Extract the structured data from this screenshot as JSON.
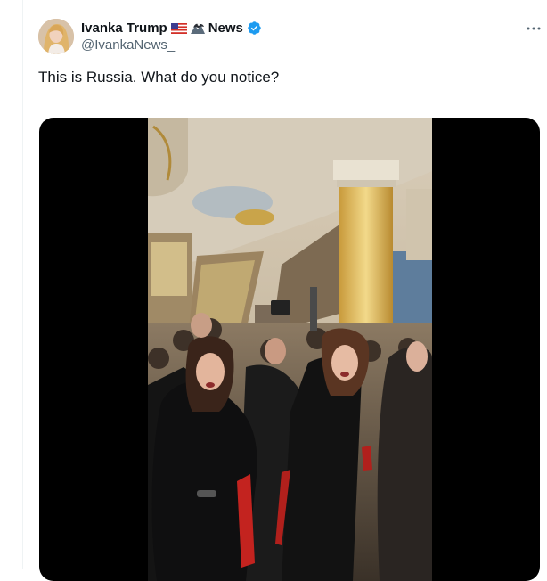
{
  "tweet": {
    "display_name_part1": "Ivanka Trump",
    "display_name_part2": "News",
    "flag_emoji": "us-flag",
    "eagle_emoji": "eagle-mountain",
    "verified_badge": "verified-badge-icon",
    "handle": "@IvankaNews_",
    "text": "This is Russia. What do you notice?",
    "more_icon": "more-horizontal-icon"
  },
  "colors": {
    "text_primary": "#0f1419",
    "text_secondary": "#536471",
    "verified_blue": "#1d9bf0",
    "divider": "#eff3f4",
    "media_background": "#000000"
  }
}
